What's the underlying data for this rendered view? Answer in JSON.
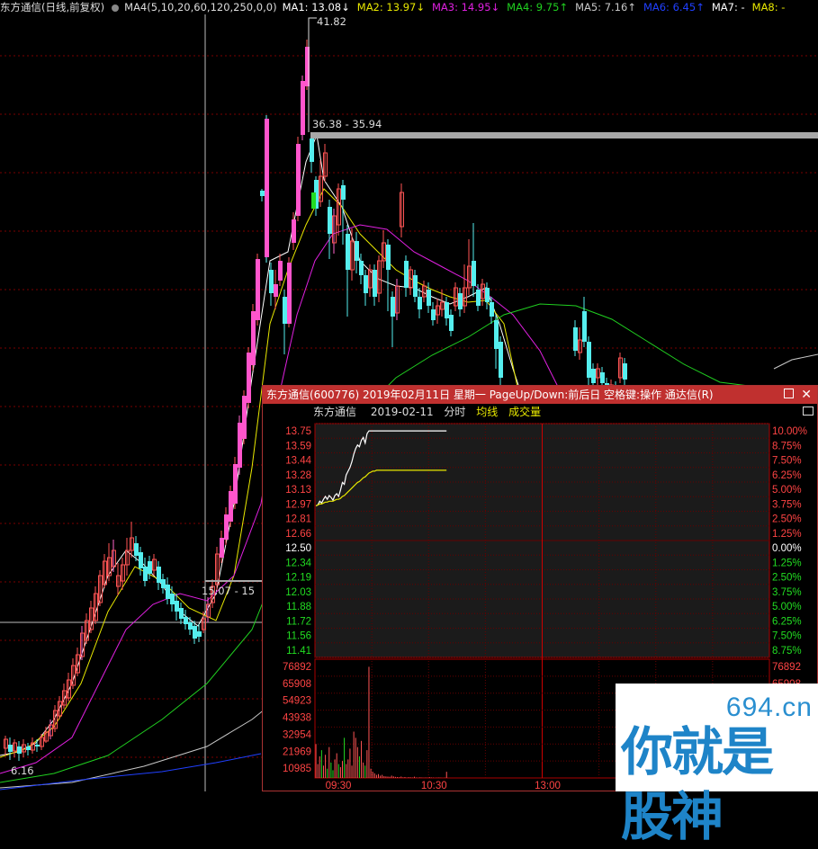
{
  "header": {
    "title": "东方通信(日线,前复权)",
    "indicator": "MA4(5,10,20,60,120,250,0,0)",
    "ma": [
      {
        "label": "MA1: 13.08↓",
        "color": "#ffffff"
      },
      {
        "label": "MA2: 13.97↓",
        "color": "#e8e800"
      },
      {
        "label": "MA3: 14.95↓",
        "color": "#e020e0"
      },
      {
        "label": "MA4: 9.75↑",
        "color": "#20d020"
      },
      {
        "label": "MA5: 7.16↑",
        "color": "#c8c8c8"
      },
      {
        "label": "MA6: 6.45↑",
        "color": "#2040ff"
      },
      {
        "label": "MA7: -",
        "color": "#ffffff"
      },
      {
        "label": "MA8: -",
        "color": "#e8e800"
      }
    ]
  },
  "price_labels": {
    "high": "41.82",
    "top_range": "36.38 - 35.94",
    "mid_range": "15.07 - 15",
    "low": "6.16"
  },
  "popup": {
    "title": "东方通信(600776) 2019年02月11日 星期一 PageUp/Down:前后日 空格键:操作 通达信(R)",
    "sub_name": "东方通信",
    "sub_date": "2019-02-11",
    "sub_type": "分时",
    "sub_avg": "均线",
    "sub_vol": "成交量"
  },
  "chart_data": {
    "type": "line",
    "price_axis_left": [
      "13.75",
      "13.59",
      "13.44",
      "13.28",
      "13.13",
      "12.97",
      "12.81",
      "12.66",
      "12.50",
      "12.34",
      "12.19",
      "12.03",
      "11.88",
      "11.72",
      "11.56",
      "11.41"
    ],
    "price_axis_right": [
      "10.00%",
      "8.75%",
      "7.50%",
      "6.25%",
      "5.00%",
      "3.75%",
      "2.50%",
      "1.25%",
      "0.00%",
      "1.25%",
      "2.50%",
      "3.75%",
      "5.00%",
      "6.25%",
      "7.50%",
      "8.75%"
    ],
    "volume_axis_left": [
      "76892",
      "65908",
      "54923",
      "43938",
      "32954",
      "21969",
      "10985"
    ],
    "volume_axis_right": [
      "76892",
      "65908"
    ],
    "time_labels": [
      "09:30",
      "10:30",
      "13:00"
    ],
    "prev_close": 12.5,
    "price_max": 13.75,
    "price_min": 11.41,
    "volume_max": 76892,
    "price_series": [
      12.95,
      12.96,
      13.0,
      12.98,
      13.02,
      13.05,
      13.02,
      13.06,
      13.04,
      13.01,
      13.06,
      13.08,
      13.05,
      13.12,
      13.2,
      13.18,
      13.28,
      13.32,
      13.36,
      13.42,
      13.5,
      13.56,
      13.6,
      13.58,
      13.65,
      13.68,
      13.62,
      13.72,
      13.75,
      13.75,
      13.75,
      13.75,
      13.75,
      13.75,
      13.75,
      13.75,
      13.75,
      13.75,
      13.75,
      13.75,
      13.75,
      13.75,
      13.75,
      13.75,
      13.75,
      13.75,
      13.75,
      13.75,
      13.75,
      13.75,
      13.75,
      13.75,
      13.75,
      13.75,
      13.75,
      13.75,
      13.75,
      13.75,
      13.75,
      13.75,
      13.75,
      13.75,
      13.75,
      13.75,
      13.75,
      13.75,
      13.75,
      13.75,
      13.75,
      13.75
    ],
    "avg_series": [
      12.95,
      12.96,
      12.97,
      12.97,
      12.98,
      12.99,
      12.99,
      13.0,
      13.0,
      13.0,
      13.01,
      13.02,
      13.02,
      13.03,
      13.05,
      13.06,
      13.08,
      13.1,
      13.12,
      13.14,
      13.16,
      13.18,
      13.2,
      13.21,
      13.23,
      13.25,
      13.26,
      13.28,
      13.3,
      13.31,
      13.32,
      13.32,
      13.33,
      13.33,
      13.33,
      13.33,
      13.33,
      13.33,
      13.33,
      13.33,
      13.33,
      13.33,
      13.33,
      13.33,
      13.33,
      13.33,
      13.33,
      13.33,
      13.33,
      13.33,
      13.33,
      13.33,
      13.33,
      13.33,
      13.33,
      13.33,
      13.33,
      13.33,
      13.33,
      13.33,
      13.33,
      13.33,
      13.33,
      13.33,
      13.33,
      13.33,
      13.33,
      13.33,
      13.33,
      13.33
    ],
    "volume_series": [
      22000,
      9000,
      14000,
      18000,
      8000,
      15000,
      6000,
      20000,
      10000,
      5000,
      12000,
      16000,
      9000,
      7000,
      11000,
      26000,
      9000,
      12000,
      19000,
      8000,
      30000,
      26000,
      20000,
      14000,
      24000,
      10000,
      8000,
      18000,
      72000,
      6000,
      4000,
      3000,
      2000,
      2500,
      1500,
      2000,
      1200,
      1000,
      900,
      800,
      1500,
      1000,
      700,
      600,
      500,
      900,
      400,
      600,
      300,
      500,
      400,
      300,
      800,
      300,
      200,
      400,
      300,
      200,
      300,
      200,
      500,
      300,
      200,
      100,
      200,
      300,
      200,
      100,
      200,
      4000
    ]
  },
  "watermark": {
    "site": "694.cn",
    "slogan": "你就是股神"
  }
}
